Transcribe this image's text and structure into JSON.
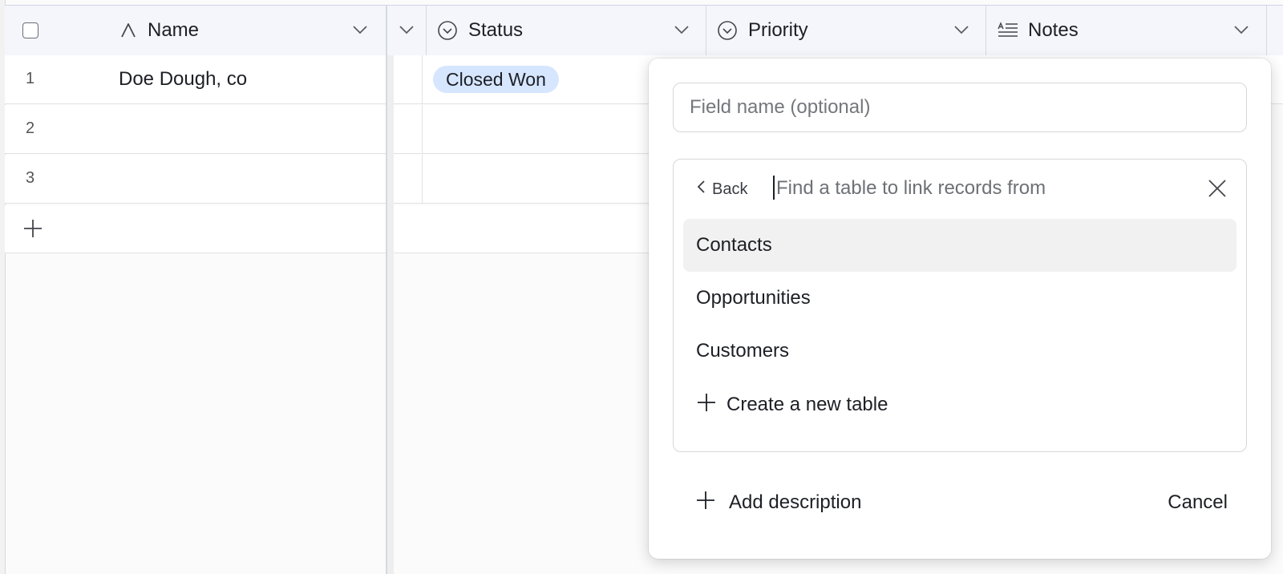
{
  "grid": {
    "columns": [
      {
        "label": "Name",
        "icon": "text-icon"
      },
      {
        "label": "Status",
        "icon": "single-select-icon"
      },
      {
        "label": "Priority",
        "icon": "single-select-icon"
      },
      {
        "label": "Notes",
        "icon": "long-text-icon"
      }
    ],
    "rows": [
      {
        "num": "1",
        "name": "Doe Dough, co",
        "status": "Closed Won"
      },
      {
        "num": "2",
        "name": "",
        "status": ""
      },
      {
        "num": "3",
        "name": "",
        "status": ""
      }
    ],
    "status_color": "#d6e6ff"
  },
  "popover": {
    "field_name_placeholder": "Field name (optional)",
    "back_label": "Back",
    "search_placeholder": "Find a table to link records from",
    "tables": [
      "Contacts",
      "Opportunities",
      "Customers"
    ],
    "create_label": "Create a new table",
    "add_description_label": "Add description",
    "cancel_label": "Cancel"
  }
}
